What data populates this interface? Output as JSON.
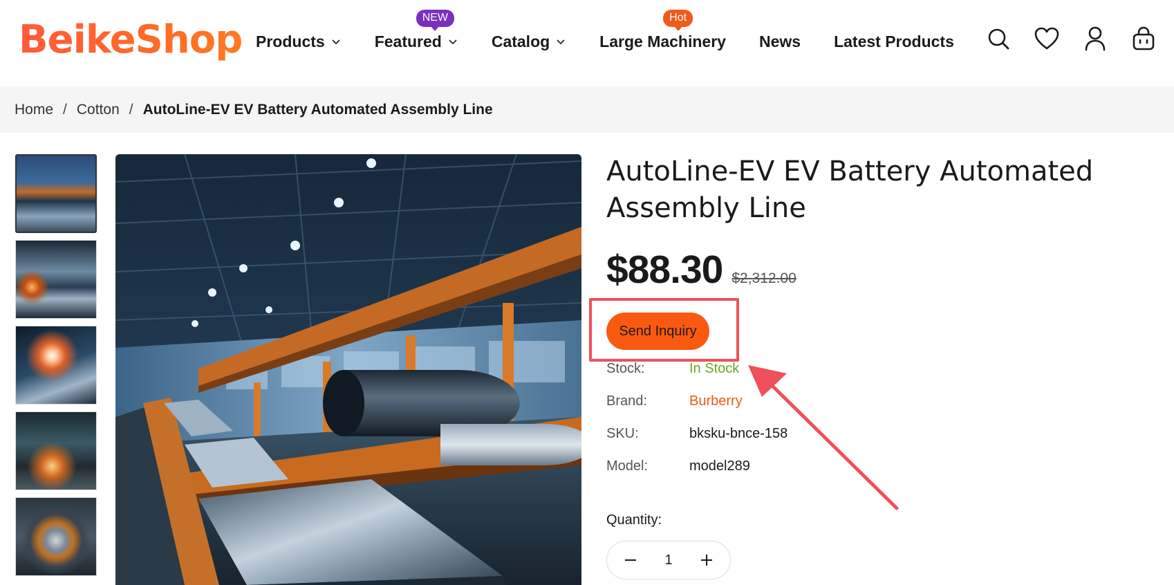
{
  "header": {
    "logo": "BeikeShop",
    "nav": [
      {
        "label": "Products",
        "has_dropdown": true
      },
      {
        "label": "Featured",
        "has_dropdown": true,
        "badge": "NEW"
      },
      {
        "label": "Catalog",
        "has_dropdown": true
      },
      {
        "label": "Large Machinery",
        "has_dropdown": false,
        "badge": "Hot"
      },
      {
        "label": "News",
        "has_dropdown": false
      },
      {
        "label": "Latest Products",
        "has_dropdown": false
      }
    ],
    "icons": [
      "search-icon",
      "heart-icon",
      "user-icon",
      "cart-icon"
    ]
  },
  "breadcrumb": {
    "items": [
      "Home",
      "Cotton"
    ],
    "current": "AutoLine-EV EV Battery Automated Assembly Line"
  },
  "product": {
    "title": "AutoLine-EV EV Battery Automated Assembly Line",
    "price": "$88.30",
    "old_price": "$2,312.00",
    "inquiry_label": "Send Inquiry",
    "attributes": [
      {
        "label": "Stock:",
        "value": "In Stock"
      },
      {
        "label": "Brand:",
        "value": "Burberry"
      },
      {
        "label": "SKU:",
        "value": "bksku-bnce-158"
      },
      {
        "label": "Model:",
        "value": "model289"
      }
    ],
    "quantity_label": "Quantity:",
    "quantity": "1"
  },
  "colors": {
    "accent": "#fa5a10",
    "stock": "#6aaa1e",
    "brand": "#f05a1a",
    "annotation": "#f0505a",
    "badge_new": "#7b2fbe",
    "badge_hot": "#f05a1a"
  }
}
